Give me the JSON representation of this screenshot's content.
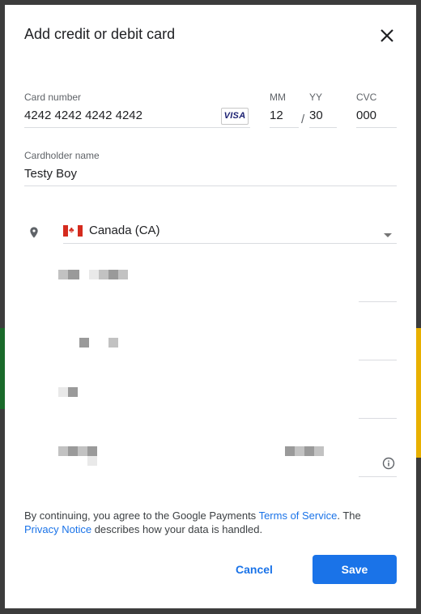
{
  "backdrop": {
    "strip_colors": [
      "#1a6a2a",
      "#e8b000"
    ]
  },
  "dialog": {
    "title": "Add credit or debit card",
    "close_icon": "close-icon"
  },
  "card": {
    "number_label": "Card number",
    "number_value": "4242  4242  4242  4242",
    "brand": "VISA",
    "mm_label": "MM",
    "mm_value": "12",
    "separator": "/",
    "yy_label": "YY",
    "yy_value": "30",
    "cvc_label": "CVC",
    "cvc_value": "000"
  },
  "cardholder": {
    "label": "Cardholder name",
    "value": "Testy Boy"
  },
  "address": {
    "location_icon": "location-pin-icon",
    "flag_icon": "canada-flag-icon",
    "country_value": "Canada (CA)",
    "dropdown_icon": "dropdown-caret-icon",
    "info_icon": "info-icon"
  },
  "footer": {
    "text_before": "By continuing, you agree to the Google Payments ",
    "terms_link": "Terms of Service",
    "text_middle": ". The ",
    "privacy_link": "Privacy Notice",
    "text_after": " describes how your data is handled."
  },
  "actions": {
    "cancel_label": "Cancel",
    "save_label": "Save"
  },
  "colors": {
    "accent": "#1a73e8",
    "backdrop": "#3c3c3c"
  }
}
